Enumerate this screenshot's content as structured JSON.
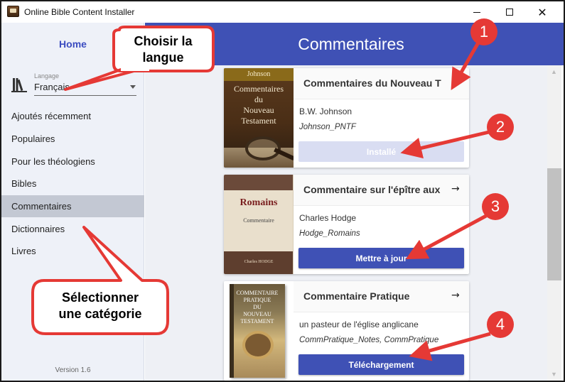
{
  "window": {
    "title": "Online Bible Content Installer",
    "minimize_glyph": "",
    "maximize_glyph": "",
    "close_glyph": "✕"
  },
  "sidebar": {
    "home_label": "Home",
    "language": {
      "caption": "Langage",
      "value": "Français"
    },
    "items": [
      {
        "label": "Ajoutés récemment",
        "active": false
      },
      {
        "label": "Populaires",
        "active": false
      },
      {
        "label": "Pour les théologiens",
        "active": false
      },
      {
        "label": "Bibles",
        "active": false
      },
      {
        "label": "Commentaires",
        "active": true
      },
      {
        "label": "Dictionnaires",
        "active": false
      },
      {
        "label": "Livres",
        "active": false
      }
    ],
    "version": "Version 1.6"
  },
  "header": {
    "title": "Commentaires"
  },
  "cards": [
    {
      "title": "Commentaires du Nouveau T",
      "author": "B.W. Johnson",
      "module": "Johnson_PNTF",
      "button": "Installé",
      "button_state": "disabled",
      "cover": {
        "top": "Johnson",
        "lines": [
          "Commentaires",
          "du",
          "Nouveau",
          "Testament"
        ]
      }
    },
    {
      "title": "Commentaire sur l'épître aux",
      "author": "Charles Hodge",
      "module": "Hodge_Romains",
      "button": "Mettre à jour",
      "button_state": "enabled",
      "cover": {
        "title": "Romains",
        "subtitle": "Commentaire",
        "author": "Charles HODGE"
      }
    },
    {
      "title": "Commentaire Pratique",
      "author": "un pasteur de l'église anglicane",
      "module": "CommPratique_Notes, CommPratique",
      "button": "Téléchargement",
      "button_state": "enabled",
      "cover": {
        "lines": [
          "COMMENTAIRE",
          "PRATIQUE",
          "DU",
          "NOUVEAU",
          "TESTAMENT"
        ]
      }
    }
  ],
  "callouts": {
    "language": [
      "Choisir la",
      "langue"
    ],
    "category": [
      "Sélectionner",
      "une catégorie"
    ],
    "numbers": [
      "1",
      "2",
      "3",
      "4"
    ]
  },
  "colors": {
    "accent": "#3f51b5",
    "callout_red": "#e53935",
    "sidebar_bg": "#eef1f8",
    "active_item": "#c3c8d3"
  },
  "icons": {
    "arrow": "→",
    "scroll_up": "▲",
    "scroll_down": "▼"
  }
}
